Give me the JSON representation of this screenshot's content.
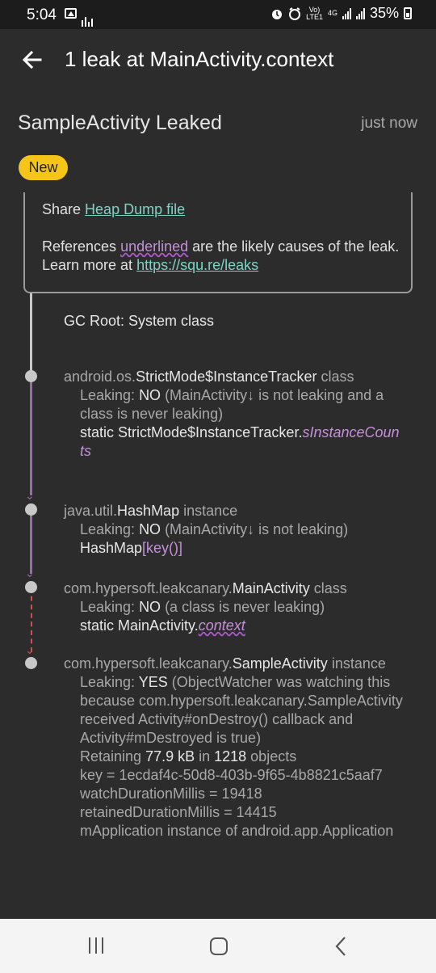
{
  "status_bar": {
    "time": "5:04",
    "volte_top": "Vo)",
    "volte_bottom": "LTE1",
    "network": "4G",
    "battery": "35%"
  },
  "app_bar": {
    "title": "1 leak at MainActivity.context",
    "back_icon": "arrow-back-icon"
  },
  "leak": {
    "title": "SampleActivity Leaked",
    "time": "just now",
    "badge": "New"
  },
  "info": {
    "share_prefix": "Share ",
    "share_link": "Heap Dump file",
    "refs_prefix": "References ",
    "refs_underlined": "underlined",
    "refs_middle": " are the likely causes of the leak. Learn more at ",
    "refs_link": "https://squ.re/leaks"
  },
  "trace": {
    "gc_root": "GC Root: System class",
    "nodes": [
      {
        "pkg": "android.os.",
        "cls": "StrictMode$InstanceTracker",
        "kind": " class",
        "leak_label": "Leaking: ",
        "leak_value": "NO",
        "leak_reason": " (MainActivity↓ is not leaking and a class is never leaking)",
        "ref_prefix": "static StrictMode$InstanceTracker.",
        "ref_field": "sInstanceCounts"
      },
      {
        "pkg": "java.util.",
        "cls": "HashMap",
        "kind": " instance",
        "leak_label": "Leaking: ",
        "leak_value": "NO",
        "leak_reason": " (MainActivity↓ is not leaking)",
        "ref_prefix": "HashMap",
        "ref_field": "[key()]"
      },
      {
        "pkg": "com.hypersoft.leakcanary.",
        "cls": "MainActivity",
        "kind": " class",
        "leak_label": "Leaking: ",
        "leak_value": "NO",
        "leak_reason": " (a class is never leaking)",
        "ref_prefix": "static MainActivity.",
        "ref_field": "context"
      },
      {
        "pkg": "com.hypersoft.leakcanary.",
        "cls": "SampleActivity",
        "kind": " instance",
        "leak_label": "Leaking: ",
        "leak_value": "YES",
        "leak_reason": " (ObjectWatcher was watching this because com.hypersoft.leakcanary.SampleActivity received Activity#onDestroy() callback and Activity#mDestroyed is true)",
        "retaining_prefix": "Retaining ",
        "retaining_size": "77.9 kB",
        "retaining_mid": " in ",
        "retaining_count": "1218",
        "retaining_suffix": " objects",
        "key": "key = 1ecdaf4c-50d8-403b-9f65-4b8821c5aaf7",
        "watch": "watchDurationMillis = 19418",
        "retained": "retainedDurationMillis = 14415",
        "mapp": "mApplication instance of android.app.Application"
      }
    ]
  },
  "nav": {
    "recent_icon": "recent-apps-icon",
    "home_icon": "home-icon",
    "back_icon": "nav-back-icon"
  }
}
